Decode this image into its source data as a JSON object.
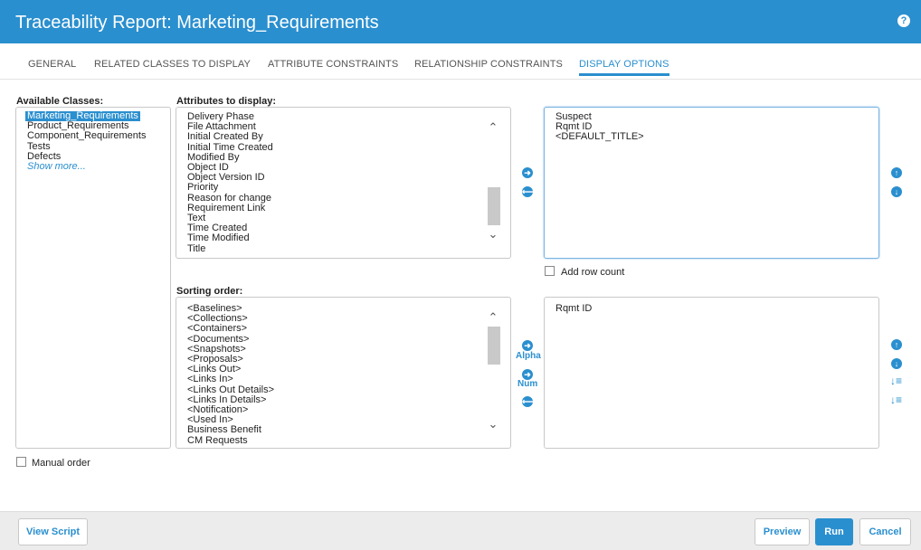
{
  "header": {
    "title": "Traceability Report: Marketing_Requirements",
    "help_icon": "question-icon"
  },
  "tabs": [
    {
      "label": "GENERAL"
    },
    {
      "label": "RELATED CLASSES TO DISPLAY"
    },
    {
      "label": "ATTRIBUTE CONSTRAINTS"
    },
    {
      "label": "RELATIONSHIP CONSTRAINTS"
    },
    {
      "label": "DISPLAY OPTIONS"
    }
  ],
  "available_classes": {
    "label": "Available Classes:",
    "items": [
      "Marketing_Requirements",
      "Product_Requirements",
      "Component_Requirements",
      "Tests",
      "Defects"
    ],
    "selected": "Marketing_Requirements",
    "show_more": "Show more..."
  },
  "attributes": {
    "label": "Attributes to display:",
    "items": [
      "Delivery Phase",
      "File Attachment",
      "Initial Created By",
      "Initial Time Created",
      "Modified By",
      "Object ID",
      "Object Version ID",
      "Priority",
      "Reason for change",
      "Requirement Link",
      "Text",
      "Time Created",
      "Time Modified",
      "Title"
    ]
  },
  "selected_attributes": {
    "items": [
      "Suspect",
      "Rqmt ID",
      "<DEFAULT_TITLE>"
    ]
  },
  "add_row_count": {
    "label": "Add row count",
    "checked": false
  },
  "sorting": {
    "label": "Sorting order:",
    "items": [
      "<Baselines>",
      "<Collections>",
      "<Containers>",
      "<Documents>",
      "<Snapshots>",
      "<Proposals>",
      "<Links Out>",
      "<Links In>",
      "<Links Out Details>",
      "<Links In Details>",
      "<Notification>",
      "<Used In>",
      "Business Benefit",
      "CM Requests"
    ],
    "alpha_label": "Alpha",
    "num_label": "Num"
  },
  "selected_sorting": {
    "items": [
      "Rqmt ID"
    ]
  },
  "manual_order": {
    "label": "Manual order",
    "checked": false
  },
  "footer": {
    "view_script": "View Script",
    "preview": "Preview",
    "run": "Run",
    "cancel": "Cancel"
  },
  "colors": {
    "accent": "#2a8fcf",
    "header_bg": "#2a8fcf",
    "footer_bg": "#ececec"
  },
  "icons": {
    "add": "arrow-right-circle-icon",
    "remove": "arrow-left-circle-icon",
    "up": "arrow-up-circle-icon",
    "down": "arrow-down-circle-icon",
    "sort_asc": "sort-ascending-icon",
    "sort_desc": "sort-descending-icon"
  }
}
